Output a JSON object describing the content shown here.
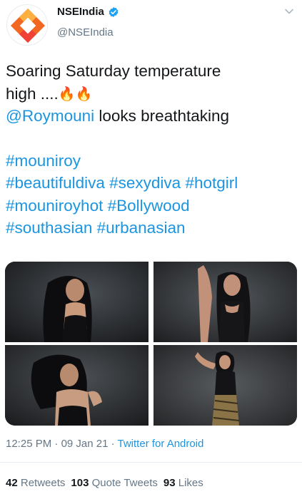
{
  "author": {
    "display_name": "NSEIndia",
    "handle": "@NSEIndia",
    "verified": true,
    "avatar_icon": "nse-logo-icon",
    "menu_icon": "chevron-down-icon"
  },
  "tweet": {
    "line1": "Soaring Saturday temperature",
    "line2": "high ....",
    "emoji": "🔥🔥",
    "mention": "@Roymouni",
    "line3_rest": " looks breathtaking",
    "hashtags": {
      "h1": "#mouniroy",
      "h2": "#beautifuldiva",
      "h3": "#sexydiva",
      "h4": "#hotgirl",
      "h5": "#mouniroyhot",
      "h6": "#Bollywood",
      "h7": "#southasian",
      "h8": "#urbanasian"
    }
  },
  "media": {
    "count": 4,
    "alt": [
      "photo-1",
      "photo-2",
      "photo-3",
      "photo-4"
    ]
  },
  "meta": {
    "time": "12:25 PM",
    "sep1": " · ",
    "date": "09 Jan 21",
    "sep2": " · ",
    "source": "Twitter for Android"
  },
  "stats": {
    "retweets_count": "42",
    "retweets_label": "Retweets",
    "quotes_count": "103",
    "quotes_label": "Quote Tweets",
    "likes_count": "93",
    "likes_label": "Likes"
  },
  "colors": {
    "link": "#1b95e0",
    "secondary": "#657786",
    "text": "#14171a",
    "logo_orange": "#f26722",
    "logo_yellow": "#fbb040",
    "logo_red": "#ef4136",
    "verified": "#1da1f2"
  }
}
